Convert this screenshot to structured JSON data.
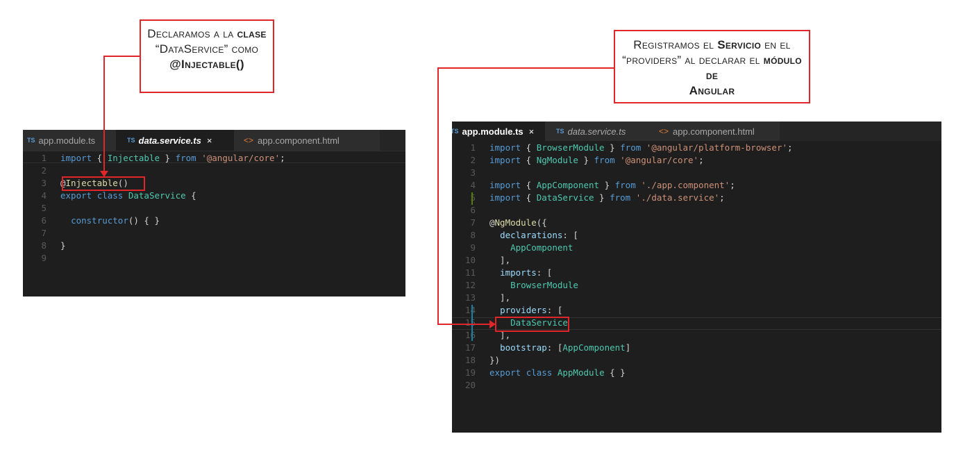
{
  "callouts": {
    "left": {
      "line1_a": "Declaramos a la ",
      "line1_b": "clase",
      "line2": "“DataService” como",
      "line3": "@Injectable()"
    },
    "right": {
      "line1_a": "Registramos el ",
      "line1_b": "Servicio",
      "line1_c": " en el",
      "line2_a": "“providers” al declarar el ",
      "line2_b": "módulo de",
      "line3": "Angular"
    }
  },
  "left_editor": {
    "tabs": [
      {
        "icon": "TS",
        "label": "app.module.ts"
      },
      {
        "icon": "TS",
        "label": "data.service.ts",
        "close": "×"
      },
      {
        "icon": "<>",
        "label": "app.component.html"
      }
    ],
    "lines": [
      {
        "n": "1",
        "tokens": [
          [
            "kw",
            "import"
          ],
          [
            "pl",
            " { "
          ],
          [
            "ty",
            "Injectable"
          ],
          [
            "pl",
            " } "
          ],
          [
            "kw",
            "from"
          ],
          [
            "pl",
            " "
          ],
          [
            "str",
            "'@angular/core'"
          ],
          [
            "pl",
            ";"
          ]
        ]
      },
      {
        "n": "2",
        "tokens": []
      },
      {
        "n": "3",
        "tokens": [
          [
            "dec",
            "@"
          ],
          [
            "fn",
            "Injectable"
          ],
          [
            "pl",
            "()"
          ]
        ]
      },
      {
        "n": "4",
        "tokens": [
          [
            "kw",
            "export"
          ],
          [
            "pl",
            " "
          ],
          [
            "kw",
            "class"
          ],
          [
            "pl",
            " "
          ],
          [
            "ty",
            "DataService"
          ],
          [
            "pl",
            " {"
          ]
        ]
      },
      {
        "n": "5",
        "tokens": []
      },
      {
        "n": "6",
        "tokens": [
          [
            "pl",
            "  "
          ],
          [
            "kw",
            "constructor"
          ],
          [
            "pl",
            "() { }"
          ]
        ]
      },
      {
        "n": "7",
        "tokens": []
      },
      {
        "n": "8",
        "tokens": [
          [
            "pl",
            "}"
          ]
        ]
      },
      {
        "n": "9",
        "tokens": []
      }
    ]
  },
  "right_editor": {
    "tabs": [
      {
        "icon": "TS",
        "label": "app.module.ts",
        "close": "×"
      },
      {
        "icon": "TS",
        "label": "data.service.ts"
      },
      {
        "icon": "<>",
        "label": "app.component.html"
      }
    ],
    "lines": [
      {
        "n": "1",
        "tokens": [
          [
            "kw",
            "import"
          ],
          [
            "pl",
            " { "
          ],
          [
            "ty",
            "BrowserModule"
          ],
          [
            "pl",
            " } "
          ],
          [
            "kw",
            "from"
          ],
          [
            "pl",
            " "
          ],
          [
            "str",
            "'@angular/platform-browser'"
          ],
          [
            "pl",
            ";"
          ]
        ]
      },
      {
        "n": "2",
        "tokens": [
          [
            "kw",
            "import"
          ],
          [
            "pl",
            " { "
          ],
          [
            "ty",
            "NgModule"
          ],
          [
            "pl",
            " } "
          ],
          [
            "kw",
            "from"
          ],
          [
            "pl",
            " "
          ],
          [
            "str",
            "'@angular/core'"
          ],
          [
            "pl",
            ";"
          ]
        ]
      },
      {
        "n": "3",
        "tokens": []
      },
      {
        "n": "4",
        "tokens": [
          [
            "kw",
            "import"
          ],
          [
            "pl",
            " { "
          ],
          [
            "ty",
            "AppComponent"
          ],
          [
            "pl",
            " } "
          ],
          [
            "kw",
            "from"
          ],
          [
            "pl",
            " "
          ],
          [
            "str",
            "'./app.component'"
          ],
          [
            "pl",
            ";"
          ]
        ]
      },
      {
        "n": "5",
        "tokens": [
          [
            "kw",
            "import"
          ],
          [
            "pl",
            " { "
          ],
          [
            "ty",
            "DataService"
          ],
          [
            "pl",
            " } "
          ],
          [
            "kw",
            "from"
          ],
          [
            "pl",
            " "
          ],
          [
            "str",
            "'./data.service'"
          ],
          [
            "pl",
            ";"
          ]
        ]
      },
      {
        "n": "6",
        "tokens": []
      },
      {
        "n": "7",
        "tokens": [
          [
            "dec",
            "@"
          ],
          [
            "fn",
            "NgModule"
          ],
          [
            "pl",
            "({"
          ]
        ]
      },
      {
        "n": "8",
        "tokens": [
          [
            "pl",
            "  "
          ],
          [
            "prop",
            "declarations"
          ],
          [
            "pl",
            ": ["
          ]
        ]
      },
      {
        "n": "9",
        "tokens": [
          [
            "pl",
            "    "
          ],
          [
            "ty",
            "AppComponent"
          ]
        ]
      },
      {
        "n": "10",
        "tokens": [
          [
            "pl",
            "  ],"
          ]
        ]
      },
      {
        "n": "11",
        "tokens": [
          [
            "pl",
            "  "
          ],
          [
            "prop",
            "imports"
          ],
          [
            "pl",
            ": ["
          ]
        ]
      },
      {
        "n": "12",
        "tokens": [
          [
            "pl",
            "    "
          ],
          [
            "ty",
            "BrowserModule"
          ]
        ]
      },
      {
        "n": "13",
        "tokens": [
          [
            "pl",
            "  ],"
          ]
        ]
      },
      {
        "n": "14",
        "tokens": [
          [
            "pl",
            "  "
          ],
          [
            "prop",
            "providers"
          ],
          [
            "pl",
            ": ["
          ]
        ]
      },
      {
        "n": "15",
        "tokens": [
          [
            "pl",
            "    "
          ],
          [
            "ty",
            "DataService"
          ]
        ]
      },
      {
        "n": "16",
        "tokens": [
          [
            "pl",
            "  ],"
          ]
        ]
      },
      {
        "n": "17",
        "tokens": [
          [
            "pl",
            "  "
          ],
          [
            "prop",
            "bootstrap"
          ],
          [
            "pl",
            ": ["
          ],
          [
            "ty",
            "AppComponent"
          ],
          [
            "pl",
            "]"
          ]
        ]
      },
      {
        "n": "18",
        "tokens": [
          [
            "pl",
            "})"
          ]
        ]
      },
      {
        "n": "19",
        "tokens": [
          [
            "kw",
            "export"
          ],
          [
            "pl",
            " "
          ],
          [
            "kw",
            "class"
          ],
          [
            "pl",
            " "
          ],
          [
            "ty",
            "AppModule"
          ],
          [
            "pl",
            " { }"
          ]
        ]
      },
      {
        "n": "20",
        "tokens": []
      }
    ]
  },
  "colors": {
    "accent": "#e0262b",
    "editor_bg": "#1e1e1e",
    "tab_bar_bg": "#252526"
  }
}
